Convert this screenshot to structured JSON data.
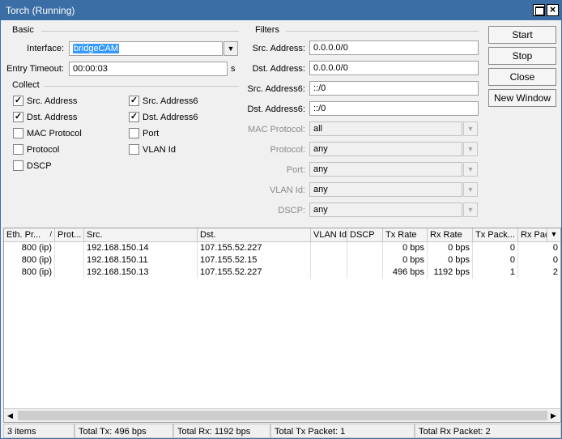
{
  "window": {
    "title": "Torch (Running)"
  },
  "basic": {
    "label": "Basic",
    "interface_label": "Interface:",
    "interface_value": "bridgeCAM",
    "entry_timeout_label": "Entry Timeout:",
    "entry_timeout_value": "00:00:03",
    "entry_timeout_unit": "s"
  },
  "collect": {
    "label": "Collect",
    "items": [
      {
        "label": "Src. Address",
        "checked": true
      },
      {
        "label": "Src. Address6",
        "checked": true
      },
      {
        "label": "Dst. Address",
        "checked": true
      },
      {
        "label": "Dst. Address6",
        "checked": true
      },
      {
        "label": "MAC Protocol",
        "checked": false
      },
      {
        "label": "Port",
        "checked": false
      },
      {
        "label": "Protocol",
        "checked": false
      },
      {
        "label": "VLAN Id",
        "checked": false
      },
      {
        "label": "DSCP",
        "checked": false
      }
    ]
  },
  "filters": {
    "label": "Filters",
    "fields": [
      {
        "label": "Src. Address:",
        "value": "0.0.0.0/0"
      },
      {
        "label": "Dst. Address:",
        "value": "0.0.0.0/0"
      },
      {
        "label": "Src. Address6:",
        "value": "::/0"
      },
      {
        "label": "Dst. Address6:",
        "value": "::/0"
      },
      {
        "label": "MAC Protocol:",
        "value": "all"
      },
      {
        "label": "Protocol:",
        "value": "any"
      },
      {
        "label": "Port:",
        "value": "any"
      },
      {
        "label": "VLAN Id:",
        "value": "any"
      },
      {
        "label": "DSCP:",
        "value": "any"
      }
    ]
  },
  "buttons": {
    "start": "Start",
    "stop": "Stop",
    "close": "Close",
    "new_window": "New Window"
  },
  "table": {
    "columns": [
      "Eth. Pr...",
      "Prot...",
      "Src.",
      "Dst.",
      "VLAN Id",
      "DSCP",
      "Tx Rate",
      "Rx Rate",
      "Tx Pack...",
      "Rx Pac"
    ],
    "sort_indicator": "/",
    "rows": [
      [
        "800 (ip)",
        "",
        "192.168.150.14",
        "107.155.52.227",
        "",
        "",
        "0 bps",
        "0 bps",
        "0",
        "0"
      ],
      [
        "800 (ip)",
        "",
        "192.168.150.11",
        "107.155.52.15",
        "",
        "",
        "0 bps",
        "0 bps",
        "0",
        "0"
      ],
      [
        "800 (ip)",
        "",
        "192.168.150.13",
        "107.155.52.227",
        "",
        "",
        "496 bps",
        "1192 bps",
        "1",
        "2"
      ]
    ]
  },
  "status": {
    "items": "3 items",
    "total_tx": "Total Tx: 496 bps",
    "total_rx": "Total Rx: 1192 bps",
    "total_tx_packet": "Total Tx Packet: 1",
    "total_rx_packet": "Total Rx Packet: 2"
  },
  "colors": {
    "titlebar": "#3a6ea5",
    "selection": "#3399ff"
  }
}
